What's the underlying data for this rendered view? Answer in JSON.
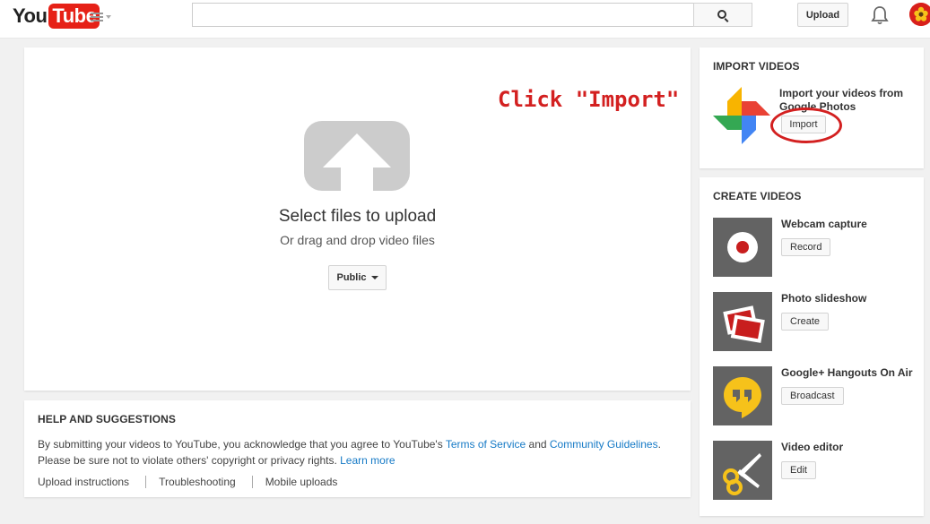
{
  "header": {
    "logo_you": "You",
    "logo_tube": "Tube",
    "search_placeholder": "",
    "upload_label": "Upload"
  },
  "upload": {
    "title": "Select files to upload",
    "subtitle": "Or drag and drop video files",
    "privacy_label": "Public"
  },
  "annotation": {
    "text": "Click \"Import\"",
    "color": "#d32020"
  },
  "help": {
    "title": "HELP AND SUGGESTIONS",
    "text_prefix": "By submitting your videos to YouTube, you acknowledge that you agree to YouTube's ",
    "terms_link": "Terms of Service",
    "and": " and ",
    "guidelines_link": "Community Guidelines",
    "text_suffix": ".",
    "line2": "Please be sure not to violate others' copyright or privacy rights. ",
    "learn_more": "Learn more",
    "links": [
      "Upload instructions",
      "Troubleshooting",
      "Mobile uploads"
    ]
  },
  "import_videos": {
    "title": "IMPORT VIDEOS",
    "text": "Import your videos from Google Photos",
    "button": "Import"
  },
  "create_videos": {
    "title": "CREATE VIDEOS",
    "items": [
      {
        "label": "Webcam capture",
        "button": "Record",
        "icon": "record-icon"
      },
      {
        "label": "Photo slideshow",
        "button": "Create",
        "icon": "photos-slideshow-icon"
      },
      {
        "label": "Google+ Hangouts On Air",
        "button": "Broadcast",
        "icon": "hangouts-icon"
      },
      {
        "label": "Video editor",
        "button": "Edit",
        "icon": "scissors-icon"
      }
    ]
  },
  "colors": {
    "brand_red": "#e62117",
    "link_blue": "#167ac6",
    "annotation_red": "#d32020"
  }
}
